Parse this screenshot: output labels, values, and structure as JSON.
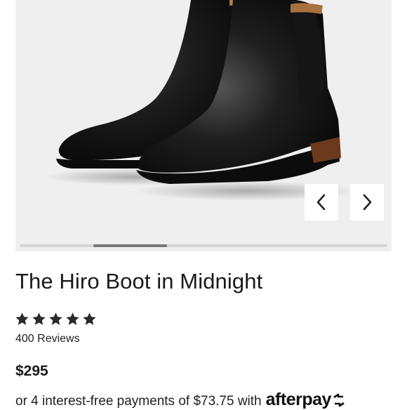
{
  "product": {
    "title": "The Hiro Boot in Midnight",
    "rating": 5,
    "rating_max": 5,
    "reviews_text": "400 Reviews",
    "price": "$295"
  },
  "gallery": {
    "image_icon": "boot-photo",
    "prev_icon": "chevron-left-icon",
    "next_icon": "chevron-right-icon",
    "scroll_position": 0.2,
    "scroll_visible_fraction": 0.2
  },
  "payment": {
    "installment_text": "or 4 interest-free payments of $73.75 with",
    "provider_logo_text": "afterpay"
  },
  "colors": {
    "gallery_bg": "#efefef",
    "text": "#1a1a1a",
    "star": "#2a2a2a",
    "scroll_track": "#d4d4d4",
    "scroll_thumb": "#777777"
  }
}
